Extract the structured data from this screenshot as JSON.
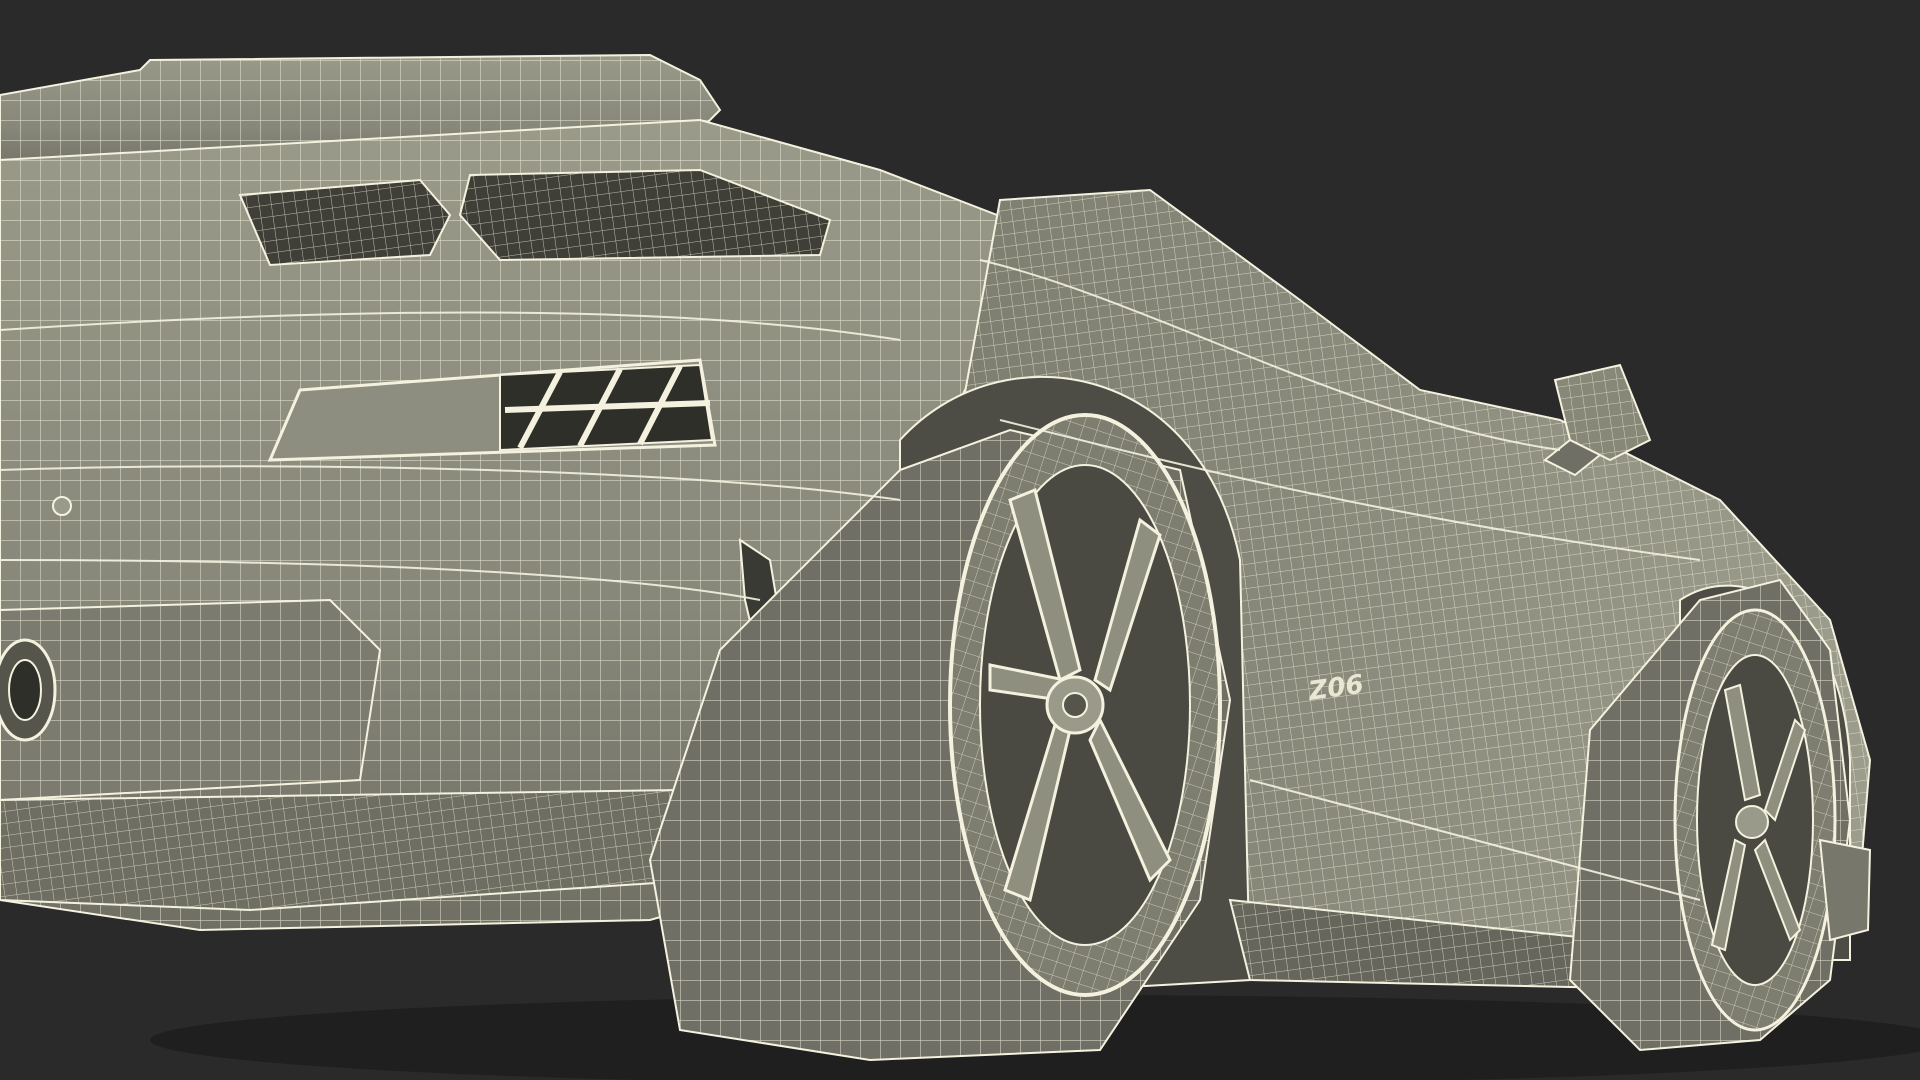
{
  "scene": {
    "subject": "wireframe-sports-car",
    "badge_text": "Z06",
    "colors": {
      "background": "#2a2a2a",
      "body_fill": "#8a8a7b",
      "body_shadow": "#5f5f55",
      "body_highlight": "#a7a796",
      "wire": "#f4f2df",
      "dark_opening": "#3a3a34",
      "tire": "#6f6f65"
    }
  }
}
